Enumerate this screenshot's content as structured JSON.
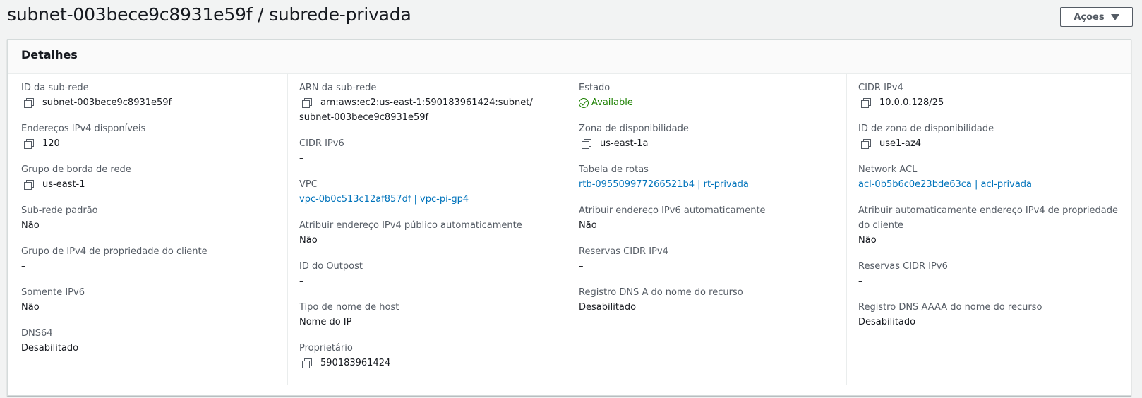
{
  "page": {
    "title": "subnet-003bece9c8931e59f / subrede-privada",
    "actions_label": "Ações"
  },
  "panel": {
    "title": "Detalhes"
  },
  "col1": {
    "subnet_id": {
      "label": "ID da sub-rede",
      "value": "subnet-003bece9c8931e59f"
    },
    "available_ipv4": {
      "label": "Endereços IPv4 disponíveis",
      "value": "120"
    },
    "network_border_group": {
      "label": "Grupo de borda de rede",
      "value": "us-east-1"
    },
    "default_subnet": {
      "label": "Sub-rede padrão",
      "value": "Não"
    },
    "customer_owned_ipv4_pool": {
      "label": "Grupo de IPv4 de propriedade do cliente",
      "value": "–"
    },
    "ipv6_only": {
      "label": "Somente IPv6",
      "value": "Não"
    },
    "dns64": {
      "label": "DNS64",
      "value": "Desabilitado"
    }
  },
  "col2": {
    "subnet_arn": {
      "label": "ARN da sub-rede",
      "value_line1": "arn:aws:ec2:us-east-1:590183961424:subnet/",
      "value_line2": "subnet-003bece9c8931e59f"
    },
    "ipv6_cidr": {
      "label": "CIDR IPv6",
      "value": "–"
    },
    "vpc": {
      "label": "VPC",
      "value": "vpc-0b0c513c12af857df | vpc-pi-gp4"
    },
    "auto_assign_public_ipv4": {
      "label": "Atribuir endereço IPv4 público automaticamente",
      "value": "Não"
    },
    "outpost_id": {
      "label": "ID do Outpost",
      "value": "–"
    },
    "hostname_type": {
      "label": "Tipo de nome de host",
      "value": "Nome do IP"
    },
    "owner": {
      "label": "Proprietário",
      "value": "590183961424"
    }
  },
  "col3": {
    "state": {
      "label": "Estado",
      "value": "Available"
    },
    "availability_zone": {
      "label": "Zona de disponibilidade",
      "value": "us-east-1a"
    },
    "route_table": {
      "label": "Tabela de rotas",
      "value": "rtb-095509977266521b4 | rt-privada"
    },
    "auto_assign_ipv6": {
      "label": "Atribuir endereço IPv6 automaticamente",
      "value": "Não"
    },
    "ipv4_cidr_reservations": {
      "label": "Reservas CIDR IPv4",
      "value": "–"
    },
    "dns_a_record": {
      "label": "Registro DNS A do nome do recurso",
      "value": "Desabilitado"
    }
  },
  "col4": {
    "ipv4_cidr": {
      "label": "CIDR IPv4",
      "value": "10.0.0.128/25"
    },
    "availability_zone_id": {
      "label": "ID de zona de disponibilidade",
      "value": "use1-az4"
    },
    "network_acl": {
      "label": "Network ACL",
      "value": "acl-0b5b6c0e23bde63ca | acl-privada"
    },
    "auto_assign_customer_ipv4": {
      "label_line1": "Atribuir automaticamente endereço IPv4 de propriedade",
      "label_line2": "do cliente",
      "value": "Não"
    },
    "ipv6_cidr_reservations": {
      "label": "Reservas CIDR IPv6",
      "value": "–"
    },
    "dns_aaaa_record": {
      "label": "Registro DNS AAAA do nome do recurso",
      "value": "Desabilitado"
    }
  },
  "colors": {
    "link": "#0073bb",
    "success": "#1d8102",
    "label": "#545b64"
  }
}
